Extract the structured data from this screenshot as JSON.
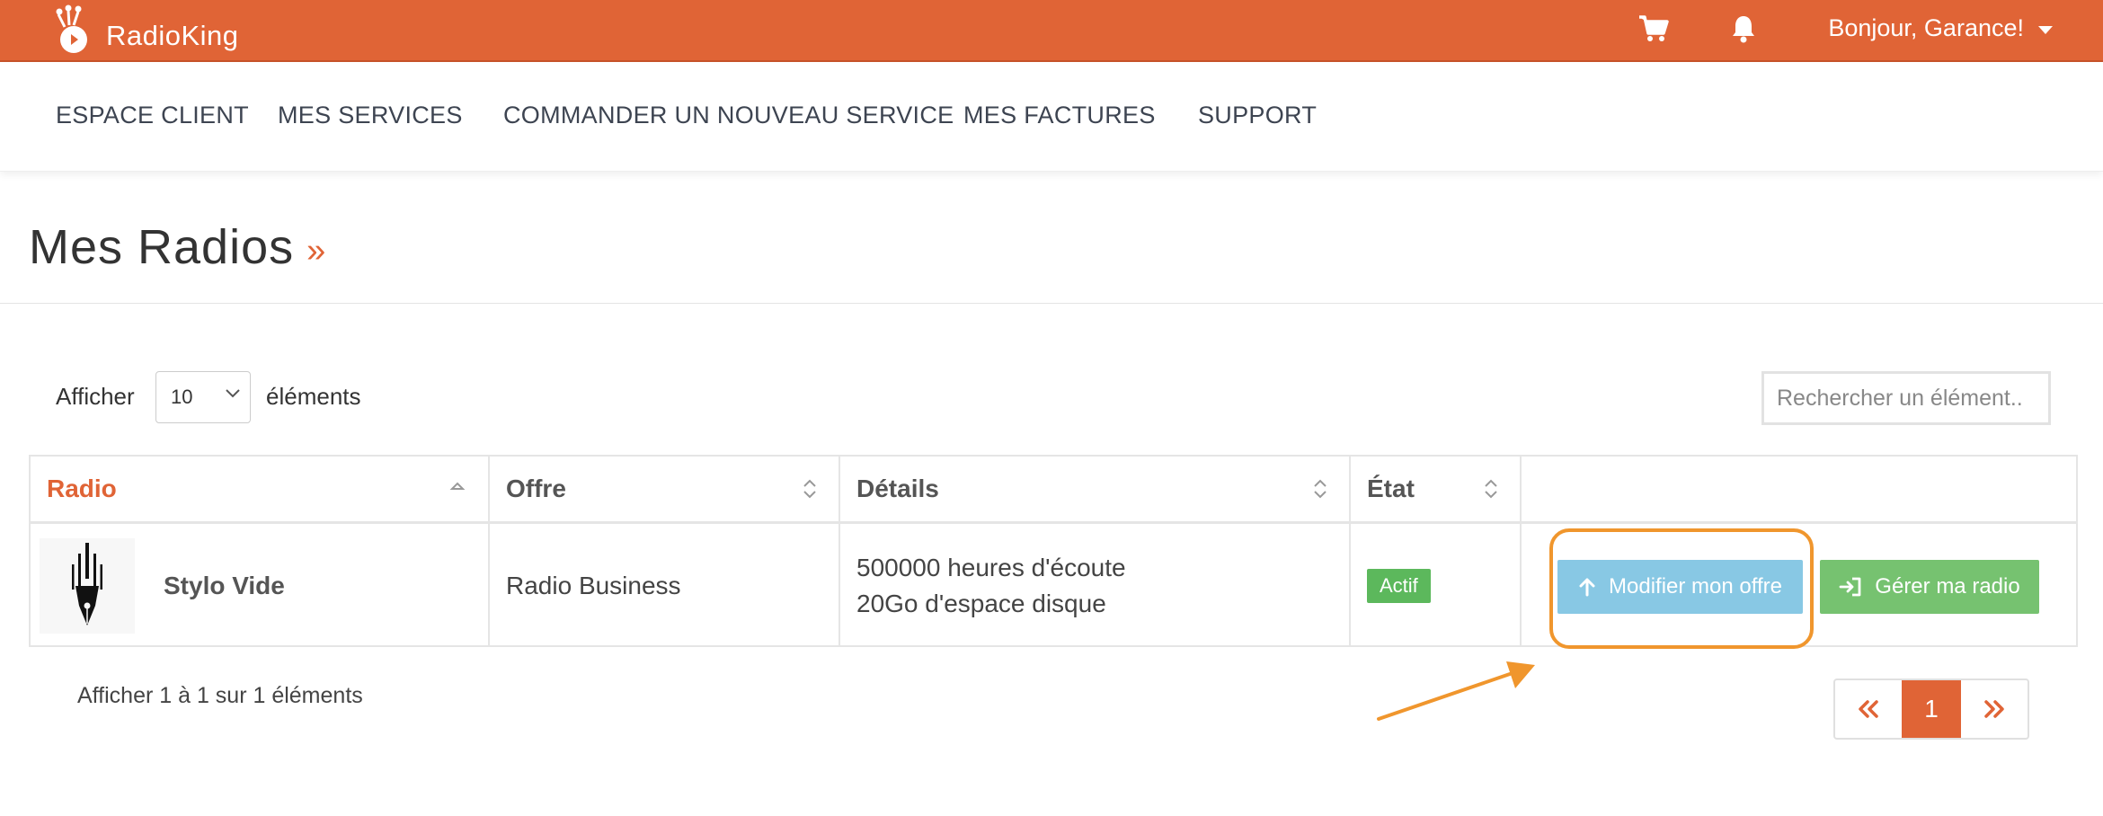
{
  "topbar": {
    "brand": "RadioKing",
    "greeting": "Bonjour, Garance!",
    "icons": [
      "cart-icon",
      "bell-icon"
    ],
    "color": "#e06436"
  },
  "nav": {
    "items": [
      {
        "label": "ESPACE CLIENT"
      },
      {
        "label": "MES SERVICES"
      },
      {
        "label": "COMMANDER UN NOUVEAU SERVICE"
      },
      {
        "label": "MES FACTURES"
      },
      {
        "label": "SUPPORT"
      }
    ]
  },
  "page": {
    "title": "Mes Radios",
    "title_suffix": "»"
  },
  "controls": {
    "show_label": "Afficher",
    "page_size": "10",
    "elements_label": "éléments",
    "search_placeholder": "Rechercher un élément.."
  },
  "table": {
    "columns": [
      "Radio",
      "Offre",
      "Détails",
      "État",
      ""
    ],
    "rows": [
      {
        "radio": "Stylo Vide",
        "offer": "Radio Business",
        "details_line1": "500000 heures d'écoute",
        "details_line2": "20Go d'espace disque",
        "status": "Actif",
        "modify_label": "Modifier mon offre",
        "manage_label": "Gérer ma radio"
      }
    ]
  },
  "footer": {
    "info": "Afficher 1 à 1 sur 1 éléments",
    "pagination": {
      "prev": "«",
      "current": "1",
      "next": "»"
    }
  },
  "colors": {
    "accent": "#e06436",
    "info_button": "#88c8e4",
    "success_button": "#76c270",
    "badge": "#5cb85c",
    "annotation": "#f0962d"
  }
}
